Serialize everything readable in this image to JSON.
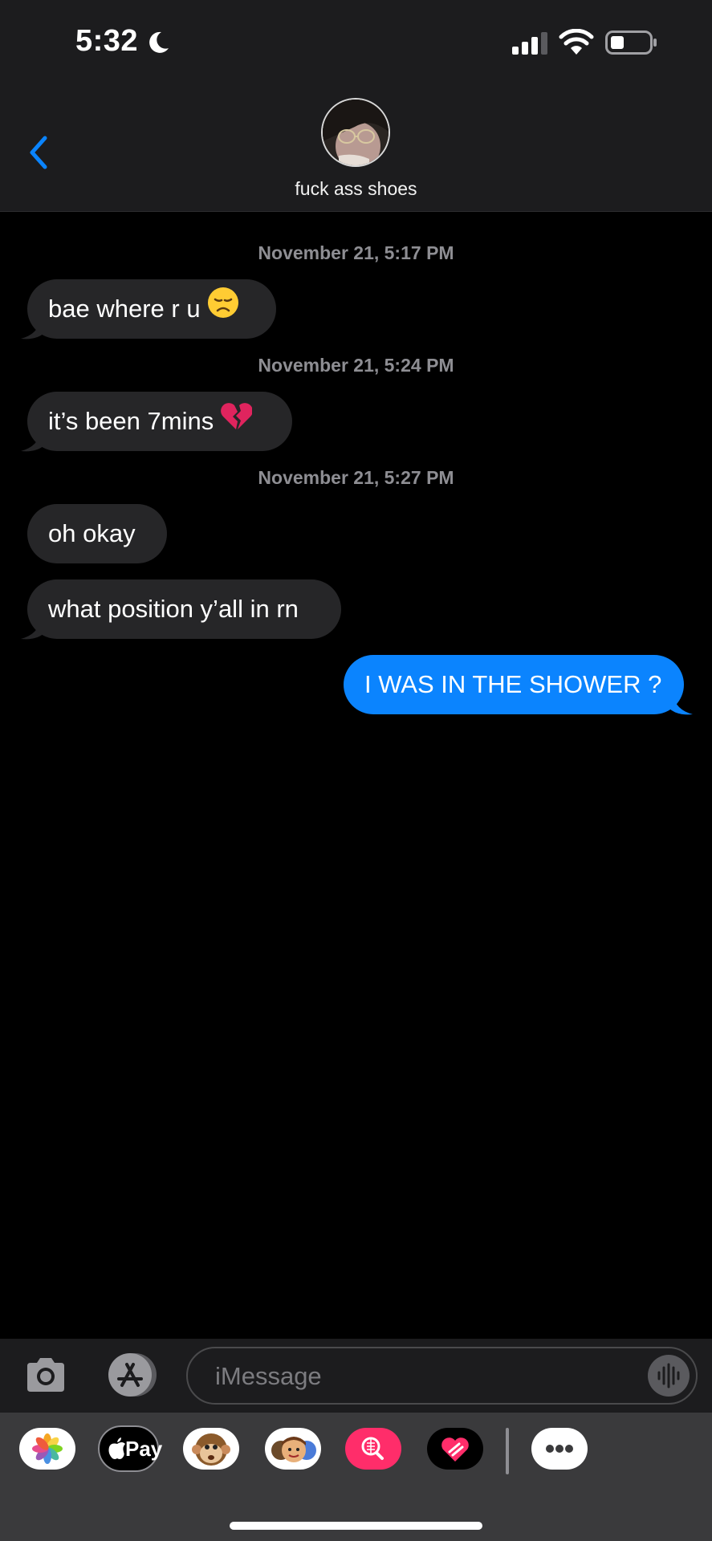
{
  "status_bar": {
    "time": "5:32"
  },
  "contact": {
    "name": "fuck ass shoes"
  },
  "messages": [
    {
      "type": "timestamp",
      "text": "November 21, 5:17 PM"
    },
    {
      "type": "incoming",
      "text": "bae where r u",
      "emoji": "disappointed-face"
    },
    {
      "type": "timestamp",
      "text": "November 21, 5:24 PM"
    },
    {
      "type": "incoming",
      "text": "it’s been 7mins",
      "emoji": "broken-heart"
    },
    {
      "type": "timestamp",
      "text": "November 21, 5:27 PM"
    },
    {
      "type": "incoming",
      "text": "oh okay"
    },
    {
      "type": "incoming",
      "text": "what position y’all in rn"
    },
    {
      "type": "outgoing",
      "text": "I WAS IN THE SHOWER ?"
    }
  ],
  "composer": {
    "placeholder": "iMessage"
  },
  "app_drawer": {
    "items": [
      "photos-app-icon",
      "apple-pay-icon",
      "animoji-icon",
      "memoji-stickers-icon",
      "image-search-icon",
      "digital-touch-icon",
      "more-apps-icon"
    ],
    "apple_pay_label": "Pay"
  },
  "colors": {
    "outgoing": "#0b84fe",
    "incoming": "#262628",
    "accent": "#0a84ff"
  }
}
